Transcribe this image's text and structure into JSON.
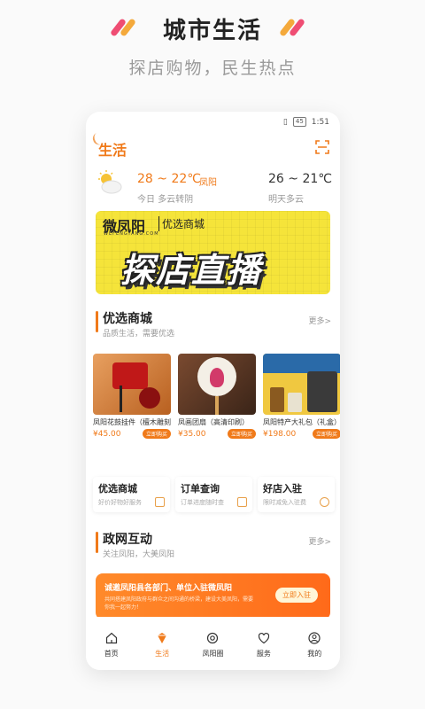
{
  "promo": {
    "title": "城市生活",
    "subtitle": "探店购物，民生热点",
    "accent_orange": "#f4a93b",
    "accent_pink": "#ef4d73"
  },
  "status_bar": {
    "time": "1:51",
    "battery": "45"
  },
  "app": {
    "title": "生活",
    "scan_icon": "scan-icon"
  },
  "weather": {
    "today_temp": "28 ~ 22℃",
    "city": "凤阳",
    "today_desc": "今日 多云转阴",
    "tomorrow_temp": "26 ~ 21℃",
    "tomorrow_desc": "明天多云",
    "icon": "partly-cloudy-icon"
  },
  "banner": {
    "brand": "微凤阳",
    "brand_sub": "WEFENGYANG.COM",
    "tag": "优选商城",
    "main": "探店直播"
  },
  "mall": {
    "title": "优选商城",
    "subtitle": "品质生活，需要优选",
    "more": "更多>",
    "products": [
      {
        "name": "凤阳花鼓挂件（檀木雕刻）",
        "price": "¥45.00",
        "buy": "立即购买"
      },
      {
        "name": "凤画团扇（高清印刷）",
        "price": "¥35.00",
        "buy": "立即购买"
      },
      {
        "name": "凤阳特产大礼包（礼盒）",
        "price": "¥198.00",
        "buy": "立即购买"
      }
    ]
  },
  "quick": [
    {
      "title": "优选商城",
      "sub": "好价好物好服务",
      "icon": "shop-icon"
    },
    {
      "title": "订单查询",
      "sub": "订单进度随时查",
      "icon": "order-icon"
    },
    {
      "title": "好店入驻",
      "sub": "限时减免入驻费",
      "icon": "store-icon"
    }
  ],
  "gov": {
    "title": "政网互动",
    "subtitle": "关注凤阳，大美凤阳",
    "more": "更多>",
    "card_title": "诚邀凤阳县各部门、单位入驻微凤阳",
    "card_sub": "共同搭建凤阳政府与群众之间沟通的桥梁，建设大美凤阳，需要你我一起努力！",
    "button": "立即入驻"
  },
  "tabs": [
    {
      "label": "首页",
      "icon": "home-icon",
      "active": false
    },
    {
      "label": "生活",
      "icon": "life-icon",
      "active": true
    },
    {
      "label": "凤阳圈",
      "icon": "circle-icon",
      "active": false
    },
    {
      "label": "服务",
      "icon": "heart-icon",
      "active": false
    },
    {
      "label": "我的",
      "icon": "user-icon",
      "active": false
    }
  ]
}
